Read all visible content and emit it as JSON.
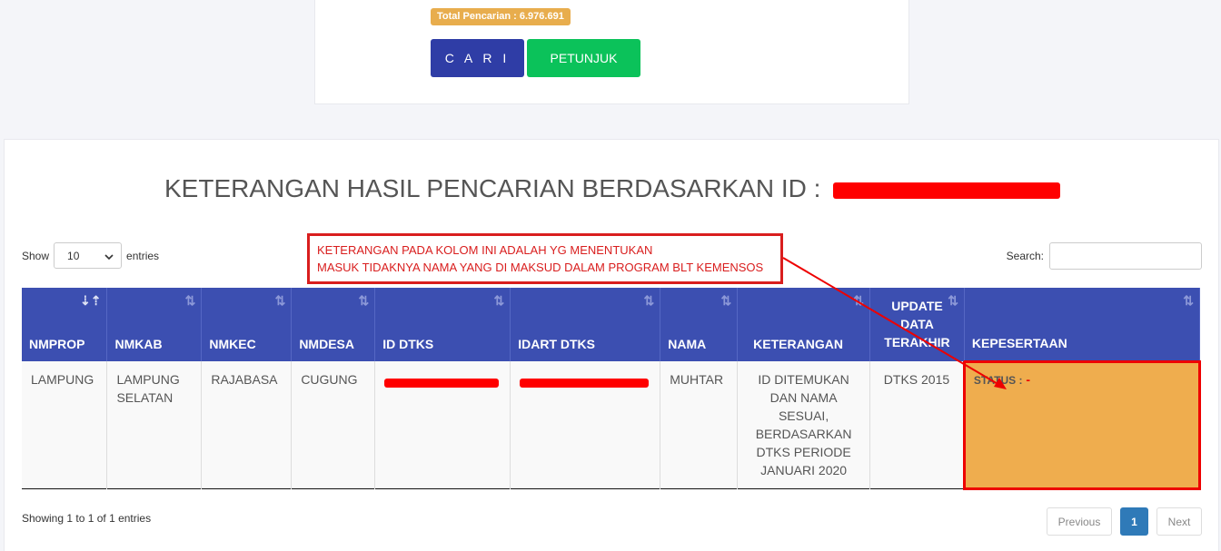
{
  "search_panel": {
    "total_badge": "Total Pencarian : 6.976.691",
    "cari_button": "C A R I",
    "petunjuk_button": "PETUNJUK"
  },
  "result": {
    "heading": "KETERANGAN HASIL PENCARIAN BERDASARKAN ID :",
    "annotation_line1": "KETERANGAN PADA KOLOM INI ADALAH YG MENENTUKAN",
    "annotation_line2": "MASUK TIDAKNYA NAMA YANG DI MAKSUD DALAM PROGRAM BLT KEMENSOS",
    "show_label": "Show",
    "entries_label": "entries",
    "page_length": "10",
    "search_label": "Search:",
    "columns": [
      "NMPROP",
      "NMKAB",
      "NMKEC",
      "NMDESA",
      "ID DTKS",
      "IDART DTKS",
      "NAMA",
      "KETERANGAN",
      "UPDATE DATA TERAKHIR",
      "KEPESERTAAN"
    ],
    "row": {
      "nmprop": "LAMPUNG",
      "nmkab": "LAMPUNG SELATAN",
      "nmkec": "RAJABASA",
      "nmdesa": "CUGUNG",
      "nama": "MUHTAR",
      "keterangan": "ID DITEMUKAN DAN NAMA SESUAI, BERDASARKAN DTKS PERIODE JANUARI 2020",
      "update": "DTKS 2015",
      "status_label": "STATUS :",
      "status_value": "-"
    },
    "showing_info": "Showing 1 to 1 of 1 entries",
    "pagination": {
      "previous": "Previous",
      "current": "1",
      "next": "Next"
    }
  },
  "colors": {
    "header": "#3c4fb1",
    "highlight": "#efad4e",
    "annotation": "#d91e1e",
    "cari": "#2f3da6",
    "petunjuk": "#0bc25a"
  }
}
